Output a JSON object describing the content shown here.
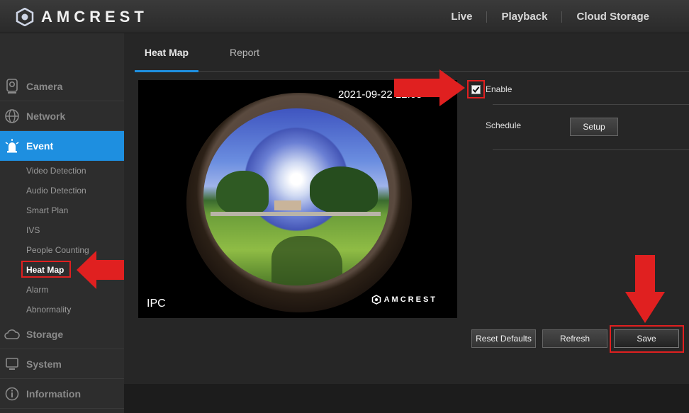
{
  "header": {
    "brand": "AMCREST",
    "nav": [
      "Live",
      "Playback",
      "Cloud Storage"
    ]
  },
  "sidebar": {
    "main_items": [
      {
        "label": "Camera",
        "icon": "camera-icon"
      },
      {
        "label": "Network",
        "icon": "globe-icon"
      },
      {
        "label": "Event",
        "icon": "alarm-icon"
      },
      {
        "label": "Storage",
        "icon": "cloud-icon"
      },
      {
        "label": "System",
        "icon": "monitor-icon"
      },
      {
        "label": "Information",
        "icon": "info-icon"
      }
    ],
    "sub_items": [
      "Video Detection",
      "Audio Detection",
      "Smart Plan",
      "IVS",
      "People Counting",
      "Heat Map",
      "Alarm",
      "Abnormality"
    ]
  },
  "tabs": [
    "Heat Map",
    "Report"
  ],
  "video": {
    "timestamp": "2021-09-22 12:05",
    "channel": "IPC",
    "watermark": "AMCREST"
  },
  "settings": {
    "enable_label": "Enable",
    "enabled": true,
    "schedule_label": "Schedule",
    "setup_label": "Setup"
  },
  "buttons": {
    "reset": "Reset Defaults",
    "refresh": "Refresh",
    "save": "Save"
  },
  "colors": {
    "accent": "#1e8fe0",
    "highlight": "#e02020"
  }
}
